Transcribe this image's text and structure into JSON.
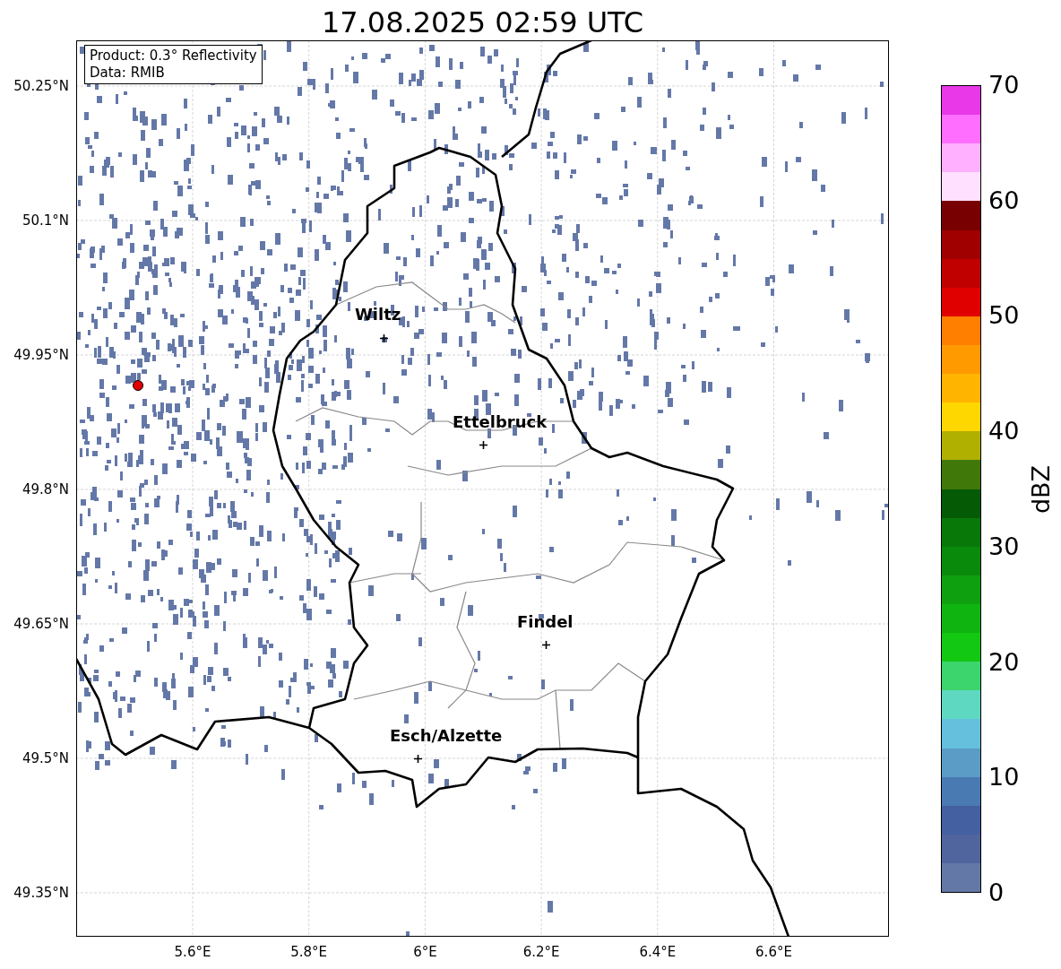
{
  "title": "17.08.2025 02:59 UTC",
  "legend": [
    "Product: 0.3° Reflectivity",
    "Data: RMIB"
  ],
  "map": {
    "yticks": [
      "50.25°N",
      "50.1°N",
      "49.95°N",
      "49.8°N",
      "49.65°N",
      "49.5°N",
      "49.35°N"
    ],
    "xticks": [
      "5.6°E",
      "5.8°E",
      "6°E",
      "6.2°E",
      "6.4°E",
      "6.6°E"
    ],
    "cities": [
      {
        "name": "Wiltz"
      },
      {
        "name": "Ettelbruck"
      },
      {
        "name": "Findel"
      },
      {
        "name": "Esch/Alzette"
      }
    ]
  },
  "colorbar": {
    "label": "dBZ",
    "ticks": [
      "70",
      "60",
      "50",
      "40",
      "30",
      "20",
      "10",
      "0"
    ],
    "bands": [
      {
        "color": "#e838e8"
      },
      {
        "color": "#ff6eff"
      },
      {
        "color": "#ffb0ff"
      },
      {
        "color": "#ffe0ff"
      },
      {
        "color": "#780000"
      },
      {
        "color": "#a00000"
      },
      {
        "color": "#c00000"
      },
      {
        "color": "#e00000"
      },
      {
        "color": "#ff7f00"
      },
      {
        "color": "#ff9a00"
      },
      {
        "color": "#ffb400"
      },
      {
        "color": "#ffd700"
      },
      {
        "color": "#b0b000"
      },
      {
        "color": "#41780a"
      },
      {
        "color": "#055a05"
      },
      {
        "color": "#087808"
      },
      {
        "color": "#0a8a0a"
      },
      {
        "color": "#0fa00f"
      },
      {
        "color": "#10b410"
      },
      {
        "color": "#12c812"
      },
      {
        "color": "#3cd46c"
      },
      {
        "color": "#5ed8c0"
      },
      {
        "color": "#64c0dc"
      },
      {
        "color": "#5a9cc6"
      },
      {
        "color": "#4a7ab2"
      },
      {
        "color": "#4460a0"
      },
      {
        "color": "#50649e"
      },
      {
        "color": "#6478a8"
      }
    ]
  }
}
